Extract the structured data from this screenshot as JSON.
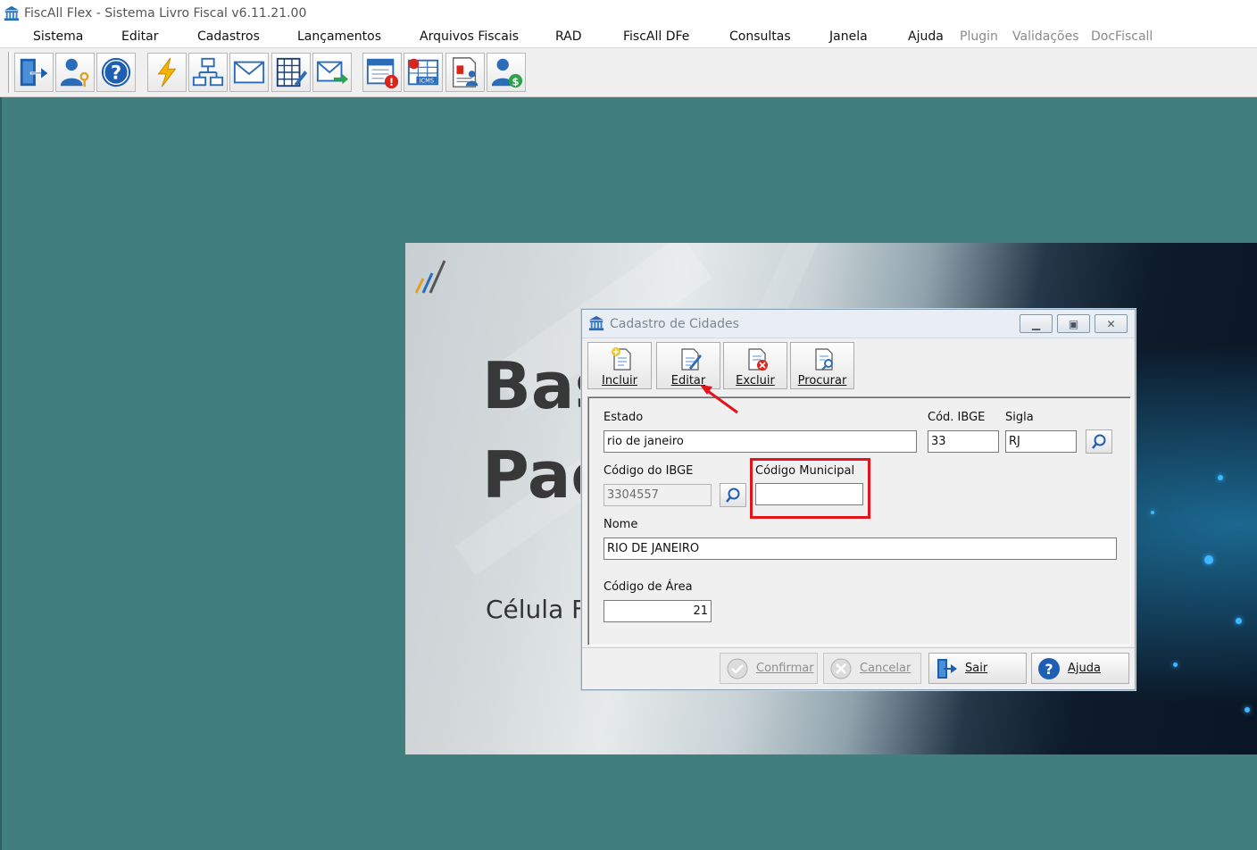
{
  "window": {
    "title": "FiscAll Flex - Sistema Livro Fiscal v6.11.21.00"
  },
  "menu": [
    {
      "label": "Sistema",
      "enabled": true
    },
    {
      "label": "Editar",
      "enabled": true
    },
    {
      "label": "Cadastros",
      "enabled": true
    },
    {
      "label": "Lançamentos",
      "enabled": true
    },
    {
      "label": "Arquivos Fiscais",
      "enabled": true
    },
    {
      "label": "RAD",
      "enabled": true
    },
    {
      "label": "FiscAll DFe",
      "enabled": true
    },
    {
      "label": "Consultas",
      "enabled": true
    },
    {
      "label": "Janela",
      "enabled": true
    },
    {
      "label": "Ajuda",
      "enabled": true
    },
    {
      "label": "Plugin",
      "enabled": false
    },
    {
      "label": "Validações",
      "enabled": false
    },
    {
      "label": "DocFiscall",
      "enabled": false
    }
  ],
  "toolbar_icons": [
    "exit-door-icon",
    "user-key-icon",
    "help-icon",
    "lightning-icon",
    "org-chart-icon",
    "envelope-icon",
    "calculator-edit-icon",
    "envelope-send-icon",
    "calendar-alert-icon",
    "icms-calendar-icon",
    "report-user-icon",
    "user-money-icon"
  ],
  "splash": {
    "big_line_1": "Bas",
    "big_line_2": "Pac",
    "subtitle": "Célula Fi"
  },
  "dialog": {
    "title": "Cadastro de Cidades",
    "tools": {
      "incluir": "Incluir",
      "editar": "Editar",
      "excluir": "Excluir",
      "procurar": "Procurar"
    },
    "fields": {
      "estado_label": "Estado",
      "estado_value": "rio de janeiro",
      "cod_ibge_label": "Cód. IBGE",
      "cod_ibge_value": "33",
      "sigla_label": "Sigla",
      "sigla_value": "RJ",
      "codigo_ibge_label": "Código do IBGE",
      "codigo_ibge_value": "3304557",
      "codigo_municipal_label": "Código Municipal",
      "codigo_municipal_value": "",
      "nome_label": "Nome",
      "nome_value": "RIO DE JANEIRO",
      "codigo_area_label": "Código de Área",
      "codigo_area_value": "21"
    },
    "footer": {
      "confirmar": "Confirmar",
      "cancelar": "Cancelar",
      "sair": "Sair",
      "ajuda": "Ajuda"
    }
  },
  "colors": {
    "workspace": "#417e7e",
    "highlight": "#e3141c",
    "accent_blue": "#1e5fb4"
  }
}
